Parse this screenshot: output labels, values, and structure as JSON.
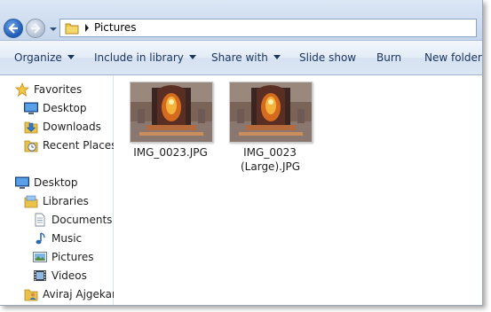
{
  "address": {
    "breadcrumb": "Pictures"
  },
  "toolbar": {
    "organize": "Organize",
    "include_in_library": "Include in library",
    "share_with": "Share with",
    "slide_show": "Slide show",
    "burn": "Burn",
    "new_folder": "New folder"
  },
  "nav": {
    "favorites": "Favorites",
    "desktop": "Desktop",
    "downloads": "Downloads",
    "recent_places": "Recent Places",
    "desktop_root": "Desktop",
    "libraries": "Libraries",
    "documents": "Documents",
    "music": "Music",
    "pictures": "Pictures",
    "videos": "Videos",
    "user": "Aviraj Ajgekar"
  },
  "files": [
    {
      "name": "IMG_0023.JPG",
      "icon": "photo-thumbnail"
    },
    {
      "name": "IMG_0023 (Large).JPG",
      "icon": "photo-thumbnail"
    }
  ]
}
